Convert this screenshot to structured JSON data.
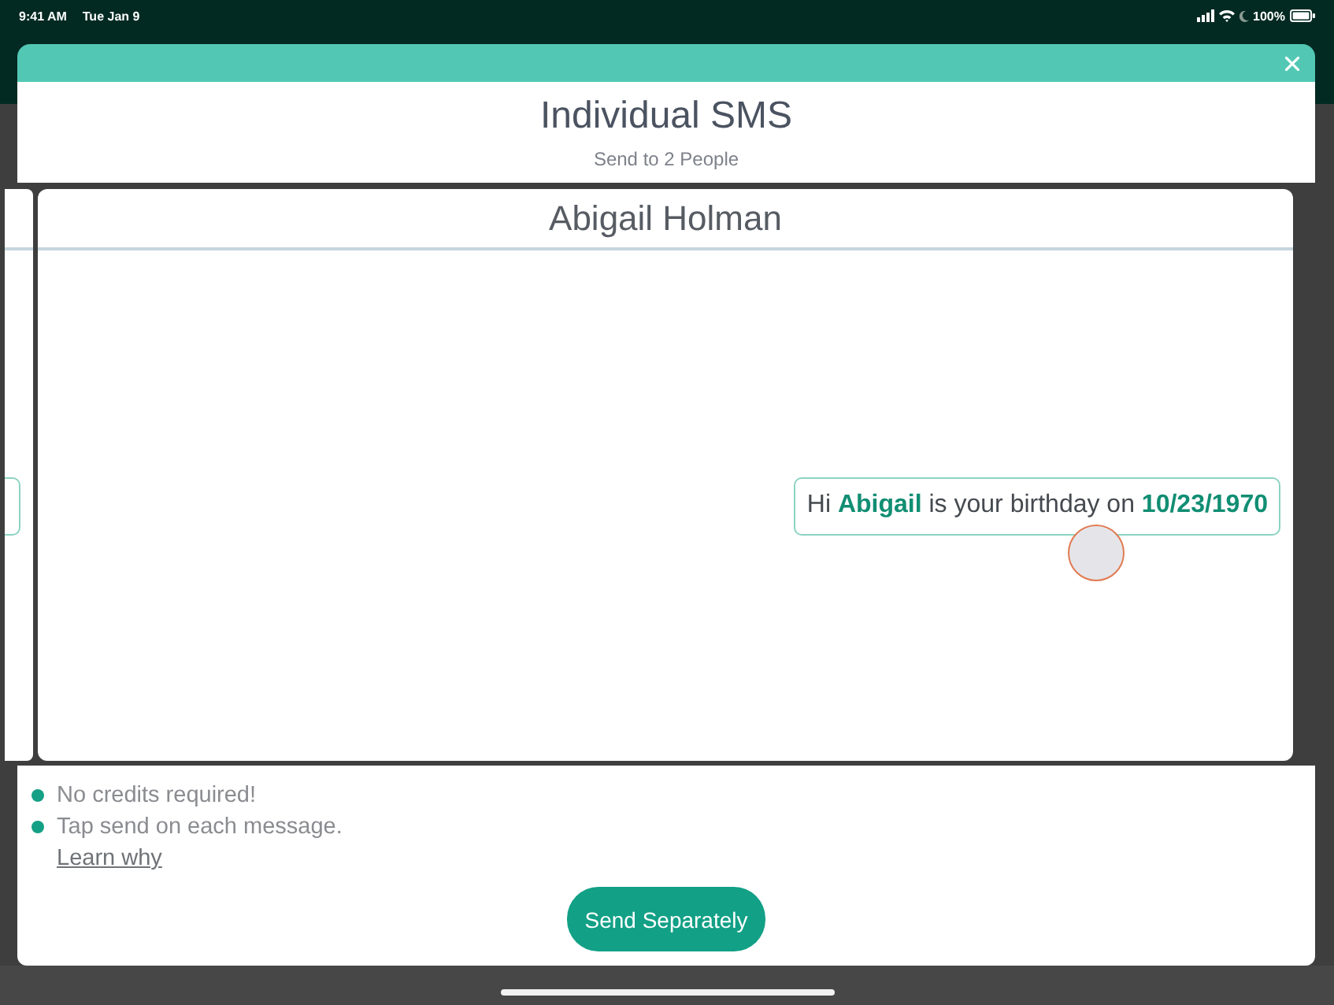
{
  "status_bar": {
    "time": "9:41 AM",
    "date": "Tue Jan 9",
    "battery": "100%"
  },
  "dialog": {
    "title": "Individual SMS",
    "subtitle": "Send to 2 People"
  },
  "message_card": {
    "recipient": "Abigail Holman",
    "message": "Hi **Abigail** is your birthday on **10/23/1970**"
  },
  "notes": [
    "No credits required!",
    "Tap send on each message."
  ],
  "learn_link": "Learn why",
  "send_button": "Send Separately"
}
